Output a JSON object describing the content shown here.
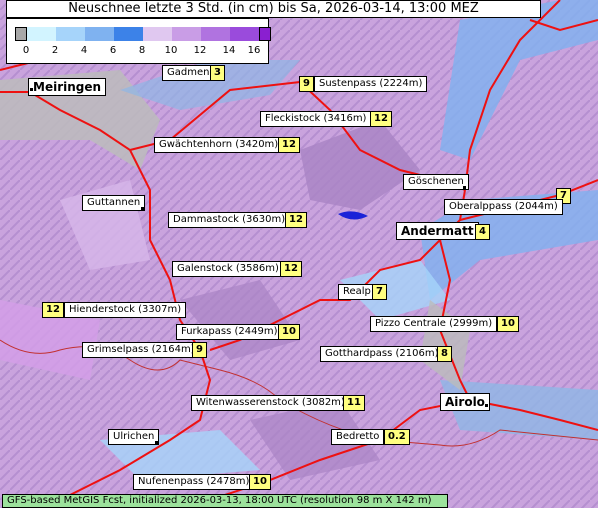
{
  "title": "Neuschnee letzte 3 Std. (in cm) bis Sa, 2026-03-14, 13:00 MEZ",
  "legend": {
    "ticks": [
      "0",
      "2",
      "4",
      "6",
      "8",
      "10",
      "12",
      "14",
      "16"
    ],
    "colors": [
      "#a8a8a8",
      "#d2f4ff",
      "#a6d4fa",
      "#7fb2f0",
      "#3c82e8",
      "#e0c8f0",
      "#c99de6",
      "#b073e0",
      "#9a4bdc",
      "#8a1fd0"
    ]
  },
  "places": [
    {
      "name": "Gadmen",
      "value": "3"
    },
    {
      "name": "Sustenpass (2224m)",
      "value": "9"
    },
    {
      "name": "Meiringen",
      "value": ""
    },
    {
      "name": "Fleckistock (3416m)",
      "value": "12"
    },
    {
      "name": "Gwächtenhorn (3420m)",
      "value": "12"
    },
    {
      "name": "Göschenen",
      "value": ""
    },
    {
      "name": "Guttannen",
      "value": ""
    },
    {
      "name": "Oberalppass (2044m)",
      "value": "7"
    },
    {
      "name": "Dammastock (3630m)",
      "value": "12"
    },
    {
      "name": "Andermatt",
      "value": "4"
    },
    {
      "name": "Galenstock (3586m)",
      "value": "12"
    },
    {
      "name": "Realp",
      "value": "7"
    },
    {
      "name": "Hienderstock (3307m)",
      "value": "12"
    },
    {
      "name": "Pizzo Centrale (2999m)",
      "value": "10"
    },
    {
      "name": "Furkapass (2449m)",
      "value": "10"
    },
    {
      "name": "Grimselpass (2164m)",
      "value": "9"
    },
    {
      "name": "Gotthardpass (2106m)",
      "value": "8"
    },
    {
      "name": "Witenwasserenstock (3082m)",
      "value": "11"
    },
    {
      "name": "Airolo",
      "value": ""
    },
    {
      "name": "Ulrichen",
      "value": ""
    },
    {
      "name": "Bedretto",
      "value": "0.2"
    },
    {
      "name": "Nufenenpass (2478m)",
      "value": "10"
    }
  ],
  "footer": "GFS-based MetGIS Fcst, initialized 2026-03-13, 18:00 UTC  (resolution 98 m X 142 m)"
}
